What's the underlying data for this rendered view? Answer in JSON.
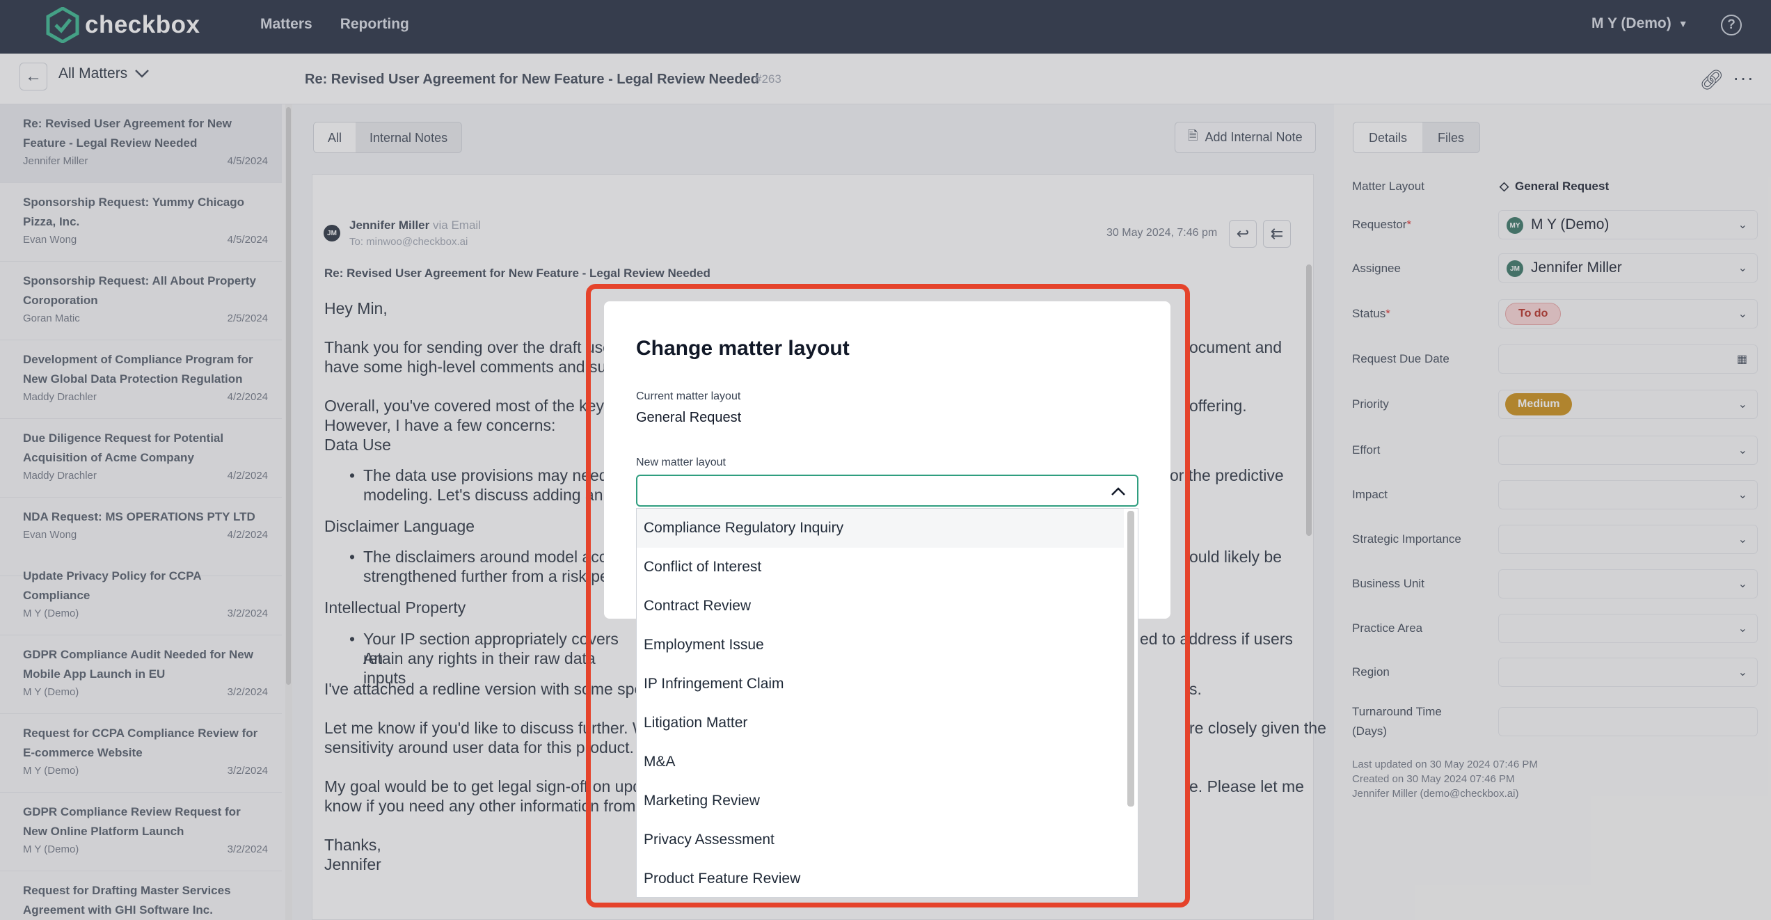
{
  "header": {
    "logo": "checkbox",
    "nav": [
      "Matters",
      "Reporting"
    ],
    "user": "M Y (Demo)"
  },
  "subheader": {
    "list_label": "All Matters",
    "title": "Re: Revised User Agreement for New Feature - Legal Review Needed",
    "number": "#263"
  },
  "sidebar": {
    "items": [
      {
        "title": "Re: Revised User Agreement for New Feature - Legal Review Needed",
        "name": "Jennifer Miller",
        "date": "4/5/2024"
      },
      {
        "title": "Sponsorship Request: Yummy Chicago Pizza, Inc.",
        "name": "Evan Wong",
        "date": "4/5/2024"
      },
      {
        "title": "Sponsorship Request: All About Property Coroporation",
        "name": "Goran Matic",
        "date": "2/5/2024"
      },
      {
        "title": "Development of Compliance Program for New Global Data Protection Regulation",
        "name": "Maddy Drachler",
        "date": "4/2/2024"
      },
      {
        "title": "Due Diligence Request for Potential Acquisition of Acme Company",
        "name": "Maddy Drachler",
        "date": "4/2/2024"
      },
      {
        "title": "NDA Request: MS OPERATIONS PTY LTD",
        "name": "Evan Wong",
        "date": "4/2/2024"
      },
      {
        "title": "Update Privacy Policy for CCPA Compliance",
        "name": "M Y (Demo)",
        "date": "3/2/2024"
      },
      {
        "title": "GDPR Compliance Audit Needed for New Mobile App Launch in EU",
        "name": "M Y (Demo)",
        "date": "3/2/2024"
      },
      {
        "title": "Request for CCPA Compliance Review for E-commerce Website",
        "name": "M Y (Demo)",
        "date": "3/2/2024"
      },
      {
        "title": "GDPR Compliance Review Request for New Online Platform Launch",
        "name": "M Y (Demo)",
        "date": "3/2/2024"
      },
      {
        "title": "Request for Drafting Master Services Agreement with GHI Software Inc.",
        "name": "",
        "date": ""
      }
    ]
  },
  "center": {
    "tabs": [
      "All",
      "Internal Notes"
    ],
    "add_note": "Add Internal Note",
    "email": {
      "avatar": "JM",
      "from_name": "Jennifer Miller",
      "via": "via Email",
      "to": "To: minwoo@checkbox.ai",
      "date": "30 May 2024, 7:46 pm",
      "subject": "Re: Revised User Agreement for New Feature - Legal Review Needed",
      "greeting": "Hey Min,",
      "p1a": "Thank you for sending over the draft use",
      "p1b": "ocument and",
      "p1c": "have some high-level comments and su",
      "p2a": "Overall, you've covered most of the key a",
      "p2b": "offering.",
      "p2c": "However, I have a few concerns:",
      "h1": "Data Use",
      "b1a": "The data use provisions may need",
      "b1b": "or the predictive",
      "b1c": "modeling. Let's discuss adding an e",
      "h2": "Disclaimer Language",
      "b2a": "The disclaimers around model accu",
      "b2b": "ould likely be",
      "b2c": "strengthened further from a risk per",
      "h3": "Intellectual Property",
      "b3a": "Your IP section appropriately covers An",
      "b3b": "ed to address if users",
      "b3c": "retain any rights in their raw data inputs",
      "p3a": "I've attached a redline version with some spe",
      "p3b": "s.",
      "p4a": "Let me know if you'd like to discuss further. W",
      "p4b": "re closely given the",
      "p4c": "sensitivity around user data for this product.",
      "p5a": "My goal would be to get legal sign-off on upda",
      "p5b": "e. Please let me",
      "p5c": "know if you need any other information from",
      "thanks": "Thanks,",
      "sign": "Jennifer"
    }
  },
  "details": {
    "tabs": [
      "Details",
      "Files"
    ],
    "matter_layout_label": "Matter Layout",
    "matter_layout_value": "General Request",
    "requestor_label": "Requestor",
    "requestor_value": "M Y (Demo)",
    "requestor_initials": "MY",
    "assignee_label": "Assignee",
    "assignee_value": "Jennifer Miller",
    "assignee_initials": "JM",
    "status_label": "Status",
    "status_value": "To do",
    "due_label": "Request Due Date",
    "priority_label": "Priority",
    "priority_value": "Medium",
    "effort_label": "Effort",
    "impact_label": "Impact",
    "strategic_label": "Strategic Importance",
    "business_label": "Business Unit",
    "practice_label": "Practice Area",
    "region_label": "Region",
    "turnaround_label1": "Turnaround Time",
    "turnaround_label2": "(Days)",
    "last_updated": "Last updated on 30 May 2024 07:46 PM",
    "created": "Created on 30 May 2024 07:46 PM",
    "creator": "Jennifer Miller (demo@checkbox.ai)"
  },
  "modal": {
    "title": "Change matter layout",
    "current_label": "Current matter layout",
    "current_value": "General Request",
    "new_label": "New matter layout",
    "options": [
      "Compliance Regulatory Inquiry",
      "Conflict of Interest",
      "Contract Review",
      "Employment Issue",
      "IP Infringement Claim",
      "Litigation Matter",
      "M&A",
      "Marketing Review",
      "Privacy Assessment",
      "Product Feature Review"
    ]
  },
  "colors": {
    "topbar": "#1b2438",
    "highlight": "#e5432b",
    "status_bg": "#fbd5d5",
    "status_fg": "#b42318",
    "priority_bg": "#c98a0c",
    "select_border": "#2f9e7f"
  }
}
